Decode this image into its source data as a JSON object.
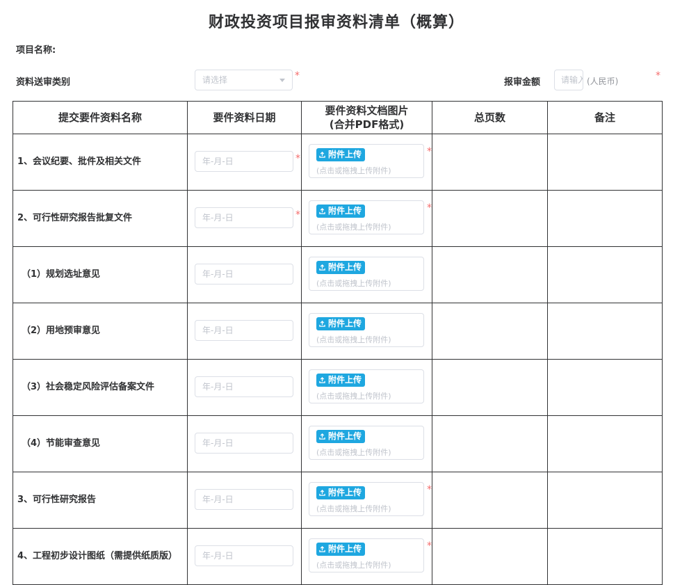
{
  "title": "财政投资项目报审资料清单（概算）",
  "project_name_label": "项目名称:",
  "category_label": "资料送审类别",
  "category_placeholder": "请选择",
  "amount_label": "报审金额",
  "amount_placeholder": "请输入",
  "amount_unit": "(人民币)",
  "required_mark": "*",
  "table": {
    "headers": {
      "name": "提交要件资料名称",
      "date": "要件资料日期",
      "doc_line1": "要件资料文档图片",
      "doc_line2": "(合并PDF格式)",
      "pages": "总页数",
      "remark": "备注"
    },
    "date_placeholder": "年-月-日",
    "upload_label": "附件上传",
    "upload_hint": "(点击或拖拽上传附件)",
    "rows": [
      {
        "name": "1、会议纪要、批件及相关文件",
        "date_required": true,
        "upload_required": true
      },
      {
        "name": "2、可行性研究报告批复文件",
        "date_required": true,
        "upload_required": true
      },
      {
        "name": "（1）规划选址意见",
        "date_required": false,
        "upload_required": false
      },
      {
        "name": "（2）用地预审意见",
        "date_required": false,
        "upload_required": false
      },
      {
        "name": "（3）社会稳定风险评估备案文件",
        "date_required": false,
        "upload_required": false
      },
      {
        "name": "（4）节能审查意见",
        "date_required": false,
        "upload_required": false
      },
      {
        "name": "3、可行性研究报告",
        "date_required": false,
        "upload_required": true
      },
      {
        "name": "4、工程初步设计图纸（需提供纸质版）",
        "date_required": false,
        "upload_required": true
      }
    ]
  }
}
